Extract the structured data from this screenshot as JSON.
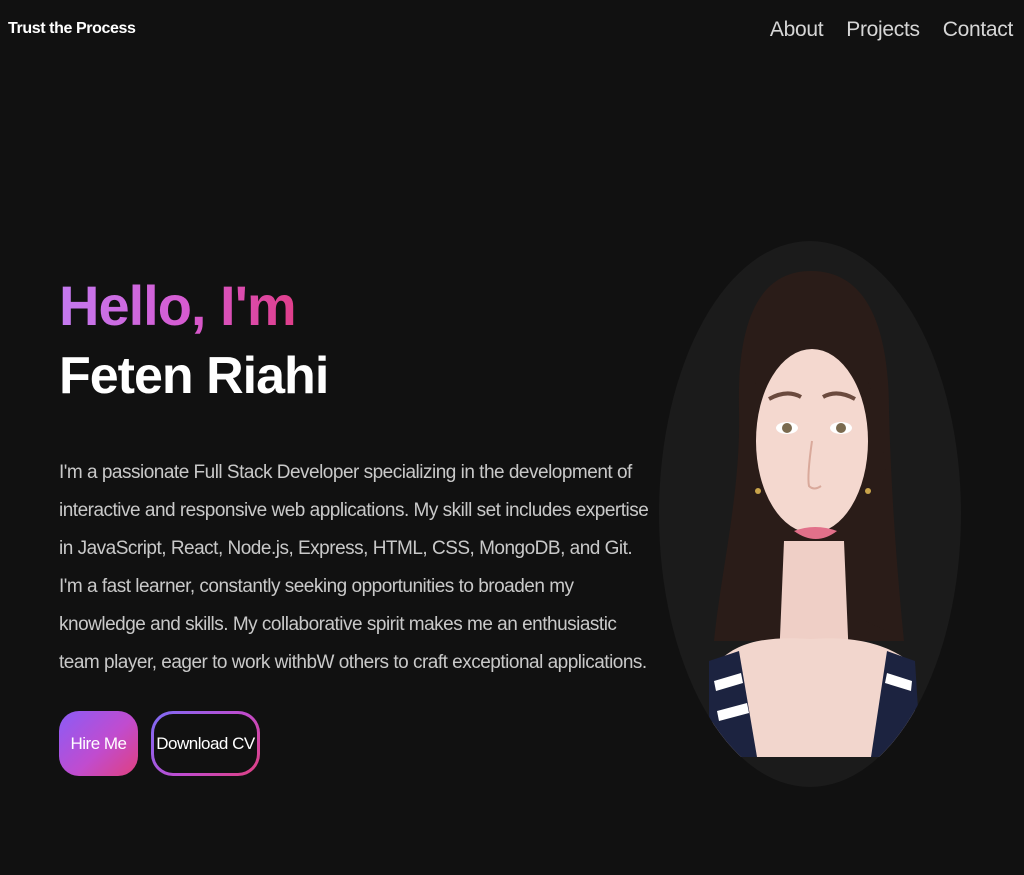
{
  "nav": {
    "brand": "Trust the Process",
    "links": [
      "About",
      "Projects",
      "Contact"
    ]
  },
  "hero": {
    "greeting": "Hello, I'm",
    "name": "Feten Riahi",
    "bio": "I'm a passionate Full Stack Developer specializing in the development of interactive and responsive web applications. My skill set includes expertise in JavaScript, React, Node.js, Express, HTML, CSS, MongoDB, and Git. I'm a fast learner, constantly seeking opportunities to broaden my knowledge and skills. My collaborative spirit makes me an enthusiastic team player, eager to work withbW others to craft exceptional applications.",
    "hire_label": "Hire Me",
    "cv_label": "Download CV"
  },
  "colors": {
    "background": "#111111",
    "accent_purple": "#c47af0",
    "accent_pink": "#e03e8a"
  }
}
